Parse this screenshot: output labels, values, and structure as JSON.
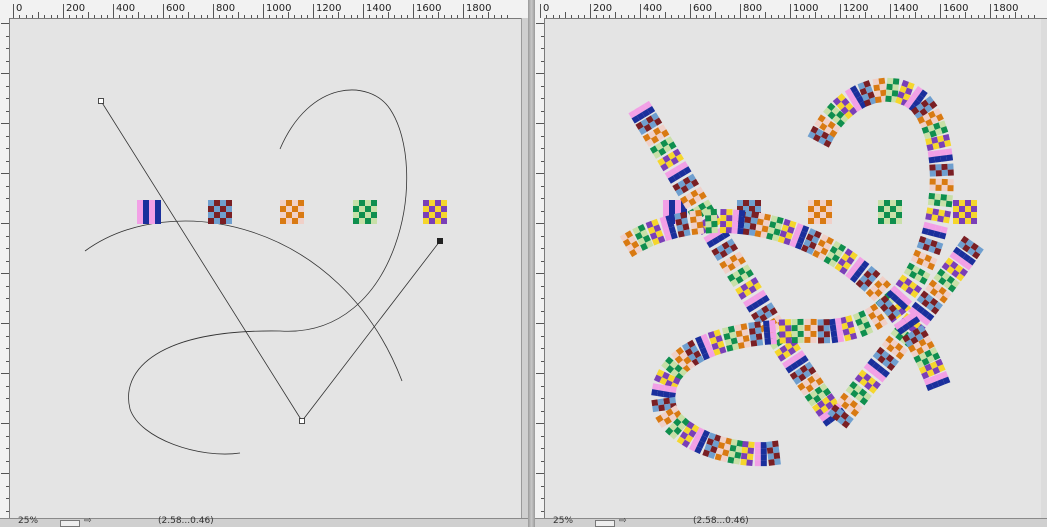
{
  "ruler": {
    "labels": [
      "0",
      "200",
      "400",
      "600",
      "800",
      "1000",
      "1200",
      "1400",
      "1600",
      "1800"
    ]
  },
  "left_pane": {
    "status": {
      "zoom": "25%",
      "doc": "(2.58...0.46)"
    }
  },
  "right_pane": {
    "status": {
      "zoom": "25%",
      "doc": "(2.58...0.46)"
    }
  },
  "swatch_palettes": [
    [
      "#f2a0e6",
      "#1a2f9c",
      "#f2a0e6",
      "#1a2f9c"
    ],
    [
      "#6f9fcf",
      "#7a1f24",
      "#7a1f24",
      "#6f9fcf"
    ],
    [
      "#f0d0c8",
      "#d97a12",
      "#d97a12",
      "#f0d0c8"
    ],
    [
      "#c8e0a8",
      "#0f8f4e",
      "#0f8f4e",
      "#c8e0a8"
    ],
    [
      "#7a3fb8",
      "#f5d62c",
      "#f5d62c",
      "#7a3fb8"
    ]
  ],
  "colors": {
    "canvas": "#e4e4e4",
    "path_stroke": "#333333"
  }
}
